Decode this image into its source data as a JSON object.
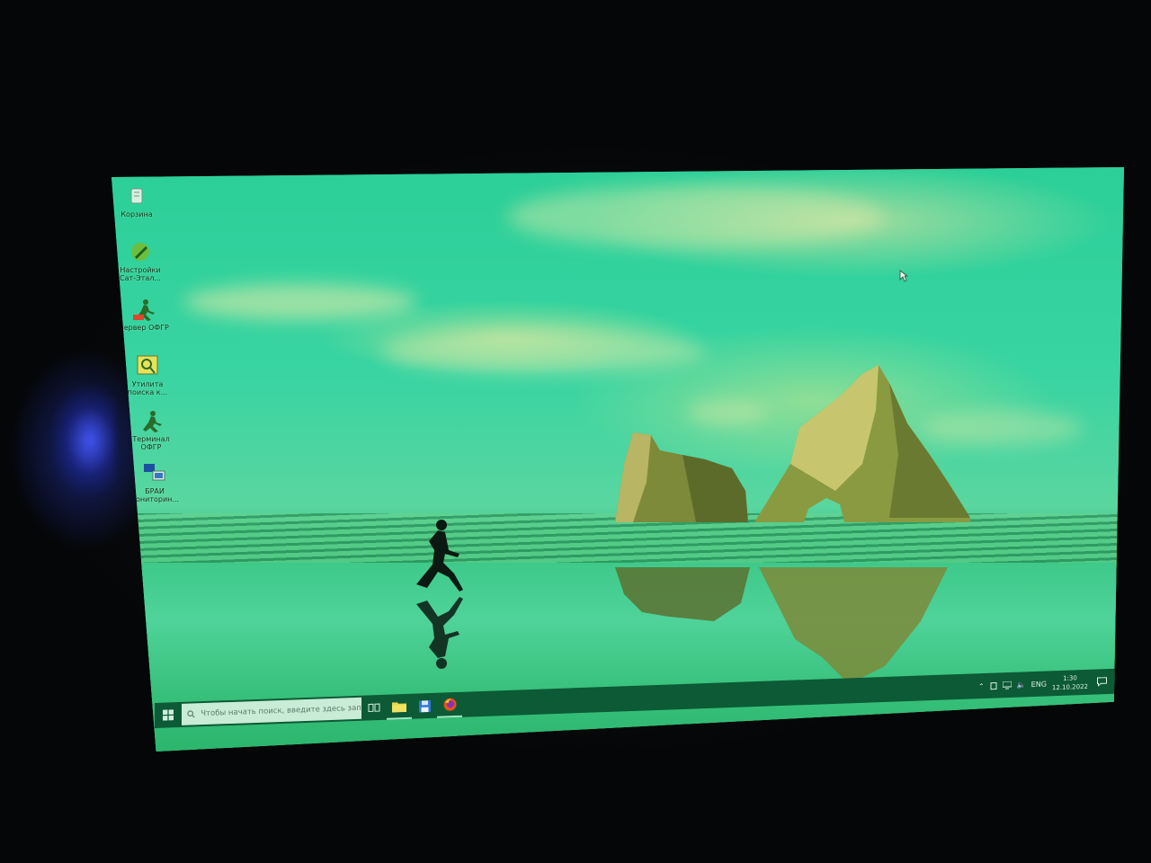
{
  "desktop": {
    "icons": [
      {
        "label": "Корзина",
        "icon": "recycle-bin-icon"
      },
      {
        "label": "Настройки Сат-Этал...",
        "icon": "settings-wrench-icon"
      },
      {
        "label": "Сервер ОФГР",
        "icon": "server-runner-icon"
      },
      {
        "label": "Утилита поиска к...",
        "icon": "search-utility-icon"
      },
      {
        "label": "Терминал ОФГР",
        "icon": "terminal-runner-icon"
      },
      {
        "label": "БРАИ мониторин...",
        "icon": "monitoring-computer-icon"
      }
    ]
  },
  "taskbar": {
    "search_placeholder": "Чтобы начать поиск, введите здесь запрос",
    "pinned": [
      "task-view-icon",
      "file-explorer-icon",
      "save-disk-icon",
      "firefox-icon"
    ],
    "tray": {
      "language": "ENG",
      "time": "1:30",
      "date": "12.10.2022"
    }
  },
  "colors": {
    "taskbar_bg": "#0d5a36",
    "search_bg": "#c9ecd6",
    "screen_tint": "#2ccf98"
  }
}
